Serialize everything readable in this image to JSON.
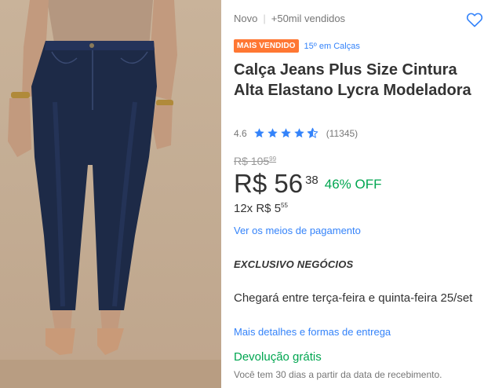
{
  "product": {
    "condition": "Novo",
    "separator": "|",
    "sold": "+50mil vendidos",
    "badge": "MAIS VENDIDO",
    "ranking": "15º em Calças",
    "title": "Calça Jeans Plus Size Cintura Alta Elastano Lycra Modeladora",
    "rating_value": "4.6",
    "rating_stars": 4.6,
    "rating_count": "(11345)",
    "old_price_main": "R$ 105",
    "old_price_cents": "99",
    "price_main": "R$ 56",
    "price_cents": "38",
    "discount": "46% OFF",
    "installments_main": "12x R$ 5",
    "installments_cents": "55",
    "payment_link": "Ver os meios de pagamento",
    "exclusive": "EXCLUSIVO NEGÓCIOS",
    "delivery": "Chegará entre terça-feira e quinta-feira 25/set",
    "shipping_link": "Mais detalhes e formas de entrega",
    "return_title": "Devolução grátis",
    "return_desc": "Você tem 30 dias a partir da data de recebimento."
  },
  "icons": {
    "favorite": "heart-outline-icon",
    "star": "star-icon"
  },
  "colors": {
    "link": "#3483fa",
    "badge": "#ff7733",
    "discount": "#00a650",
    "jeans": "#1d2a47"
  }
}
